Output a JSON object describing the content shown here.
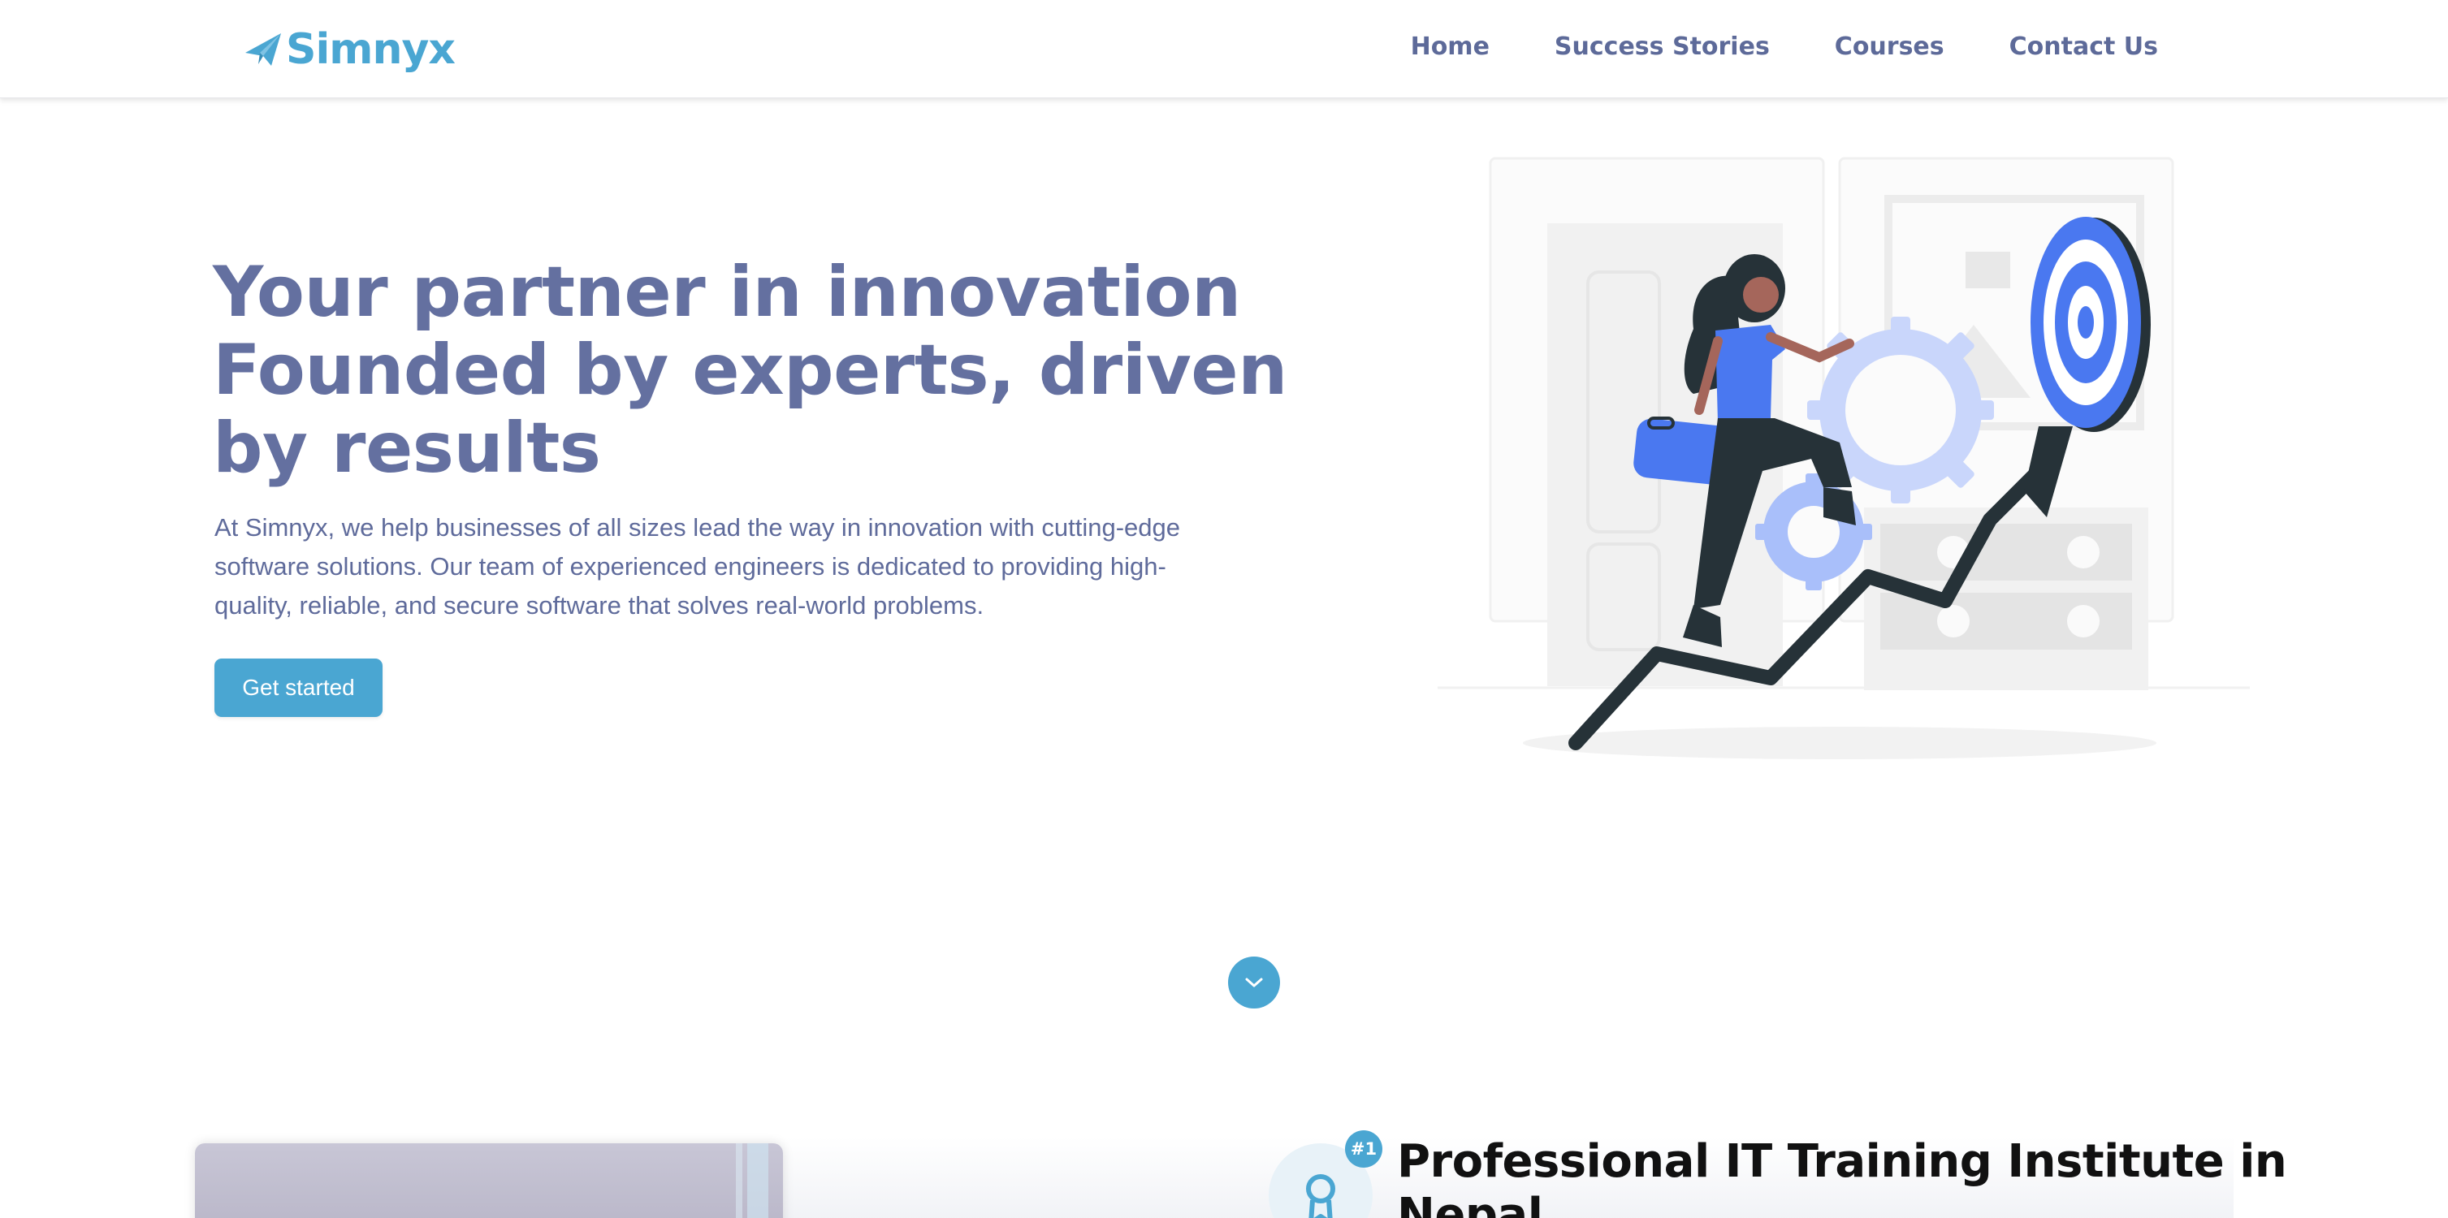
{
  "brand": {
    "name": "Simnyx",
    "accent_color": "#4aa6d2",
    "logo_icon": "paper-plane-icon"
  },
  "nav": {
    "items": [
      {
        "label": "Home"
      },
      {
        "label": "Success Stories"
      },
      {
        "label": "Courses"
      },
      {
        "label": "Contact Us"
      }
    ]
  },
  "hero": {
    "title_lines": [
      "Your partner in innovation",
      "Founded by experts, driven",
      "by results"
    ],
    "description_lines": [
      "At Simnyx, we help businesses of all sizes lead the way in innovation with cutting-edge",
      "software solutions. Our team of experienced engineers is dedicated to providing high-",
      "quality, reliable, and secure software that solves real-world problems."
    ],
    "cta_label": "Get started",
    "illustration": "woman-climbing-growth-arrow-toward-target"
  },
  "scroll": {
    "icon": "chevron-down-icon"
  },
  "section": {
    "badge": "#1",
    "badge_icon": "award-ribbon-icon",
    "title_lines": [
      "Professional IT Training Institute in",
      "Nepal"
    ]
  }
}
